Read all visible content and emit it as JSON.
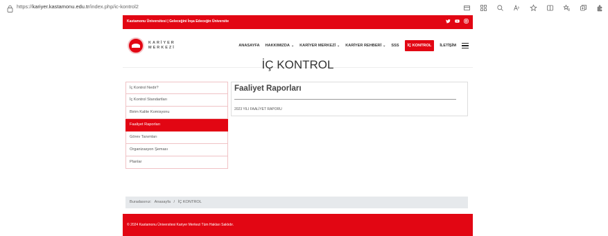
{
  "browser": {
    "url_prefix": "https://",
    "url_host": "kariyer.kastamonu.edu.tr",
    "url_path": "/index.php/ic-kontrol2",
    "tools": [
      "tab-icon",
      "grid-icon",
      "zoom-icon",
      "read-aloud-icon",
      "favorite-star-icon",
      "split-screen-icon",
      "favorites-icon",
      "collections-icon",
      "extensions-icon"
    ]
  },
  "topbar": {
    "tagline": "Kastamonu Üniversitesi | Geleceğini İnşa Edeceğin Üniversite",
    "social": [
      "twitter-icon",
      "youtube-icon",
      "instagram-icon"
    ]
  },
  "logo": {
    "line1": "KARİYER",
    "line2": "MERKEZİ"
  },
  "menu": {
    "home": "ANASAYFA",
    "about": "HAKKIMIZDA",
    "career_center": "KARİYER MERKEZİ",
    "career_guide": "KARİYER REHBERİ",
    "faq": "SSS",
    "internal_control": "İÇ KONTROL",
    "contact": "İLETİŞİM"
  },
  "page": {
    "title": "İÇ KONTROL"
  },
  "sidebar": {
    "items": [
      {
        "label": "İç Kontrol Nedir?"
      },
      {
        "label": "İç Kontrol Standartları"
      },
      {
        "label": "Birim Kalite Komisyonu"
      },
      {
        "label": "Faaliyet Raporları"
      },
      {
        "label": "Görev Tanımları"
      },
      {
        "label": "Organizasyon Şeması"
      },
      {
        "label": "Planlar"
      }
    ],
    "active_index": 3
  },
  "content": {
    "heading": "Faaliyet Raporları",
    "link": "2023 YILI FAALİYET RAPORU"
  },
  "breadcrumb": {
    "prefix": "Buradasınız:",
    "home": "Anasayfa",
    "separator": "/",
    "current": "İÇ KONTROL"
  },
  "footer": {
    "copyright": "© 2024 Kastamonu Üniversitesi Kariyer Merkezi Tüm Hakları Saklıdır."
  },
  "colors": {
    "brand_red": "#e20613",
    "breadcrumb_bg": "#e6e9ec"
  }
}
